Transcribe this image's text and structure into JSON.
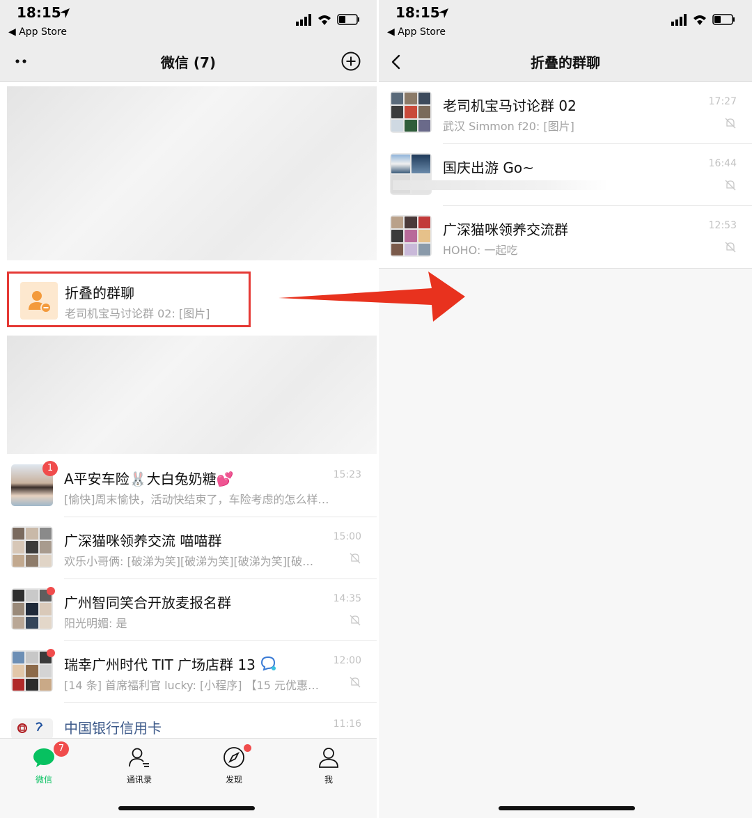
{
  "colors": {
    "accent_green": "#07c160",
    "badge_red": "#f04c4c",
    "highlight_red": "#e53935"
  },
  "left": {
    "status": {
      "time": "18:15",
      "back_label": "◀ App Store"
    },
    "nav": {
      "title": "微信 (7)"
    },
    "folded": {
      "title": "折叠的群聊",
      "subtitle": "老司机宝马讨论群 02: [图片]"
    },
    "chats": [
      {
        "title": "A平安车险🐰大白兔奶糖💕",
        "subtitle": "[愉快]周末愉快，活动快结束了，车险考虑的怎么样…",
        "time": "15:23",
        "badge": "1"
      },
      {
        "title": "广深猫咪领养交流 喵喵群",
        "subtitle": "欢乐小哥俩: [破涕为笑][破涕为笑][破涕为笑][破…",
        "time": "15:00"
      },
      {
        "title": "广州智同笑合开放麦报名群",
        "subtitle": "阳光明媚: 是",
        "time": "14:35"
      },
      {
        "title": "瑞幸广州时代 TIT 广场店群 13",
        "subtitle": "[14 条] 首席福利官 lucky: [小程序] 【15 元优惠…",
        "time": "12:00"
      },
      {
        "title": "中国银行信用卡",
        "time": "11:16"
      }
    ],
    "tabs": [
      {
        "label": "微信",
        "icon": "chat-bubble-icon",
        "badge": "7"
      },
      {
        "label": "通讯录",
        "icon": "contacts-icon"
      },
      {
        "label": "发现",
        "icon": "compass-icon"
      },
      {
        "label": "我",
        "icon": "person-icon"
      }
    ]
  },
  "right": {
    "status": {
      "time": "18:15",
      "back_label": "◀ App Store"
    },
    "nav": {
      "title": "折叠的群聊"
    },
    "chats": [
      {
        "title": "老司机宝马讨论群 02",
        "subtitle": "武汉 Simmon f20: [图片]",
        "time": "17:27"
      },
      {
        "title": "国庆出游 Go~",
        "subtitle": "",
        "time": "16:44"
      },
      {
        "title": "广深猫咪领养交流群",
        "subtitle": "HOHO: 一起吃",
        "time": "12:53"
      }
    ]
  }
}
